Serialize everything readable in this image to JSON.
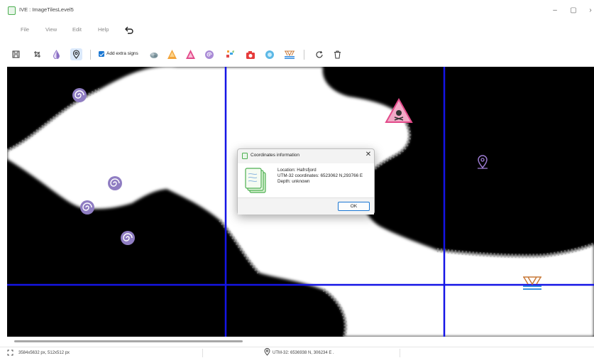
{
  "window": {
    "title": "IVE : ImageTilesLevel5",
    "minimize": "–",
    "maximize": "▢",
    "close": "›"
  },
  "menu": {
    "items": [
      "File",
      "View",
      "Edit",
      "Help"
    ]
  },
  "toolbar": {
    "add_extra_signs_label": "Add extra signs",
    "add_extra_signs_checked": true
  },
  "dialog": {
    "title": "Coordinates information",
    "close": "✕",
    "location": "Location: Hafrsfjord",
    "utm": "UTM-32 coordinates: 6523062 N,293766 E",
    "depth": "Depth: unknown",
    "ok_label": "OK"
  },
  "statusbar": {
    "dimensions": "3584x5632 px, 512x512 px",
    "coordinates": "UTM-32: 6536938 N, 306234 E ."
  },
  "colors": {
    "grid_line": "#1414e6",
    "land": "#ffffff",
    "water": "#000000",
    "accent": "#1976d2"
  },
  "icons": {
    "map_markers": [
      "spiral-icon",
      "hazard-icon",
      "location-pin-icon",
      "bridge-icon"
    ]
  }
}
